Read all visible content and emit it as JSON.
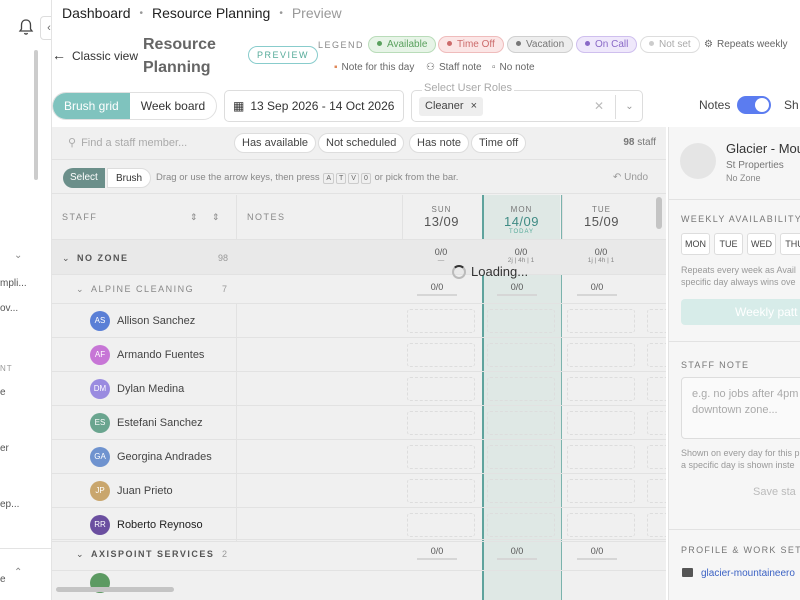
{
  "rail": {
    "items": [
      "mpli...",
      "ov...",
      "e",
      "er",
      "ep...",
      "e"
    ],
    "sub_label": "NT"
  },
  "breadcrumb": {
    "items": [
      "Dashboard",
      "Resource Planning",
      "Preview"
    ]
  },
  "header": {
    "back_label": "Classic view",
    "title": "Resource Planning",
    "badge": "PREVIEW"
  },
  "legend": {
    "label": "LEGEND",
    "items": [
      {
        "label": "Available",
        "color": "#8fc99a",
        "bg": "#e7f4e7"
      },
      {
        "label": "Time Off",
        "color": "#e08a8a",
        "bg": "#fbe6e6"
      },
      {
        "label": "Vacation",
        "color": "#999999",
        "bg": "#eeeeee"
      },
      {
        "label": "On Call",
        "color": "#a58ad8",
        "bg": "#efe8fb"
      },
      {
        "label": "Not set",
        "color": "#cccccc",
        "bg": "#ffffff"
      }
    ],
    "repeats": "Repeats weekly",
    "note_day": "Note for this day",
    "staff_note": "Staff note",
    "no_note": "No note"
  },
  "toolbar": {
    "mode_tabs": [
      "Brush grid",
      "Week board"
    ],
    "date_range": "13 Sep 2026 - 14 Oct 2026",
    "roles_label": "Select User Roles",
    "role_tag": "Cleaner",
    "notes_label": "Notes",
    "show_label": "Sh"
  },
  "filters": {
    "search_placeholder": "Find a staff member...",
    "chips": [
      "Has available",
      "Not scheduled",
      "Has note",
      "Time off"
    ],
    "count_num": "98",
    "count_word": "staff"
  },
  "brush": {
    "select": "Select",
    "brush": "Brush",
    "hint_a": "Drag or use the arrow keys, then press",
    "hint_b": "or pick from the bar.",
    "keys": [
      "A",
      "T",
      "V",
      "0"
    ],
    "undo": "Undo"
  },
  "columns": {
    "staff": "STAFF",
    "notes": "NOTES",
    "days": [
      {
        "dow": "SUN",
        "date": "13/09",
        "today": ""
      },
      {
        "dow": "MON",
        "date": "14/09",
        "today": "TODAY"
      },
      {
        "dow": "TUE",
        "date": "15/09",
        "today": ""
      }
    ]
  },
  "zone": {
    "name": "NO ZONE",
    "count": "98",
    "stats": [
      {
        "value": "0/0",
        "sub": "—"
      },
      {
        "value": "0/0",
        "sub": "2j | 4h | 1"
      },
      {
        "value": "0/0",
        "sub": "1j | 4h | 1"
      }
    ]
  },
  "groups": [
    {
      "name": "ALPINE CLEANING",
      "count": "7",
      "stats": [
        "0/0",
        "0/0",
        "0/0"
      ]
    },
    {
      "name": "AXISPOINT SERVICES",
      "count": "2",
      "stats": [
        "0/0",
        "0/0",
        "0/0"
      ]
    }
  ],
  "staff": [
    {
      "initials": "AS",
      "name": "Allison Sanchez",
      "color": "#5a7fd6"
    },
    {
      "initials": "AF",
      "name": "Armando Fuentes",
      "color": "#c776d6"
    },
    {
      "initials": "DM",
      "name": "Dylan Medina",
      "color": "#9a8be0"
    },
    {
      "initials": "ES",
      "name": "Estefani Sanchez",
      "color": "#6aa58f"
    },
    {
      "initials": "GA",
      "name": "Georgina Andrades",
      "color": "#6f93cf"
    },
    {
      "initials": "JP",
      "name": "Juan Prieto",
      "color": "#c9a66d"
    },
    {
      "initials": "RR",
      "name": "Roberto Reynoso",
      "color": "#6b4fa0"
    }
  ],
  "loading": "Loading...",
  "side": {
    "org_name": "Glacier - Mou",
    "org_sub": "St Properties",
    "org_zone": "No Zone",
    "weekly_label": "WEEKLY AVAILABILITY",
    "days": [
      "MON",
      "TUE",
      "WED",
      "THU"
    ],
    "weekly_desc1": "Repeats every week as Avail",
    "weekly_desc2": "specific day always wins ove",
    "weekly_btn": "Weekly patt",
    "note_label": "STAFF NOTE",
    "note_placeholder": "e.g. no jobs after 4pm downtown zone...",
    "note_desc1": "Shown on every day for this p",
    "note_desc2": "a specific day is shown inste",
    "save": "Save sta",
    "profile_label": "PROFILE & WORK SETUP",
    "email": "glacier-mountaineero"
  }
}
